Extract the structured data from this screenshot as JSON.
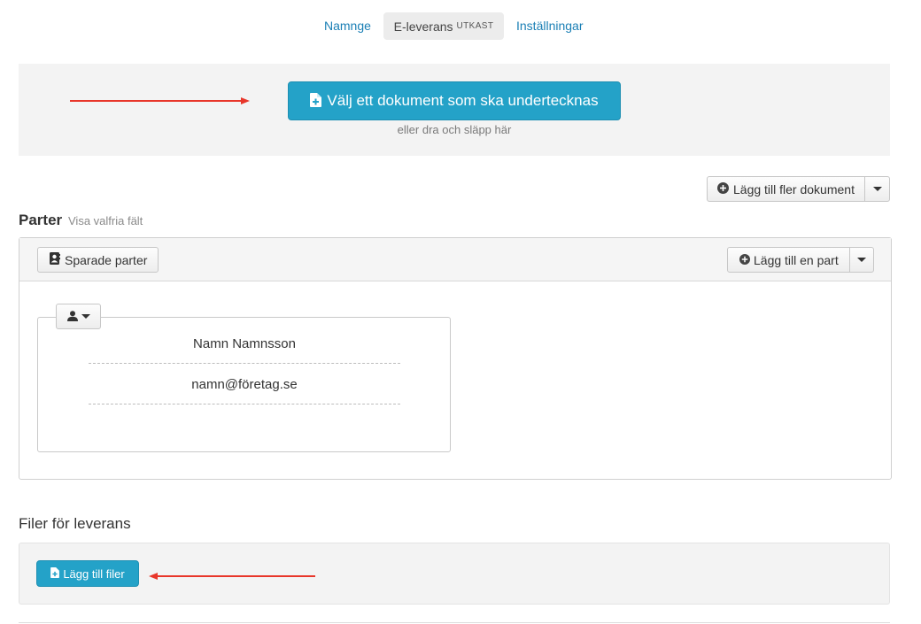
{
  "tabs": {
    "name_label": "Namnge",
    "delivery_label": "E-leverans",
    "delivery_badge": "UTKAST",
    "settings_label": "Inställningar"
  },
  "dropzone": {
    "choose_button_label": "Välj ett dokument som ska undertecknas",
    "drop_hint": "eller dra och släpp här"
  },
  "documents": {
    "add_more_label": "Lägg till fler dokument"
  },
  "parties": {
    "title": "Parter",
    "optional_fields_link": "Visa valfria fält",
    "saved_parties_label": "Sparade parter",
    "add_party_label": "Lägg till en part",
    "party": {
      "name": "Namn Namnsson",
      "email": "namn@företag.se"
    }
  },
  "files": {
    "title": "Filer för leverans",
    "add_files_label": "Lägg till filer"
  },
  "colors": {
    "primary": "#24a2c8",
    "link": "#1a7fb5",
    "annotation_arrow": "#e8362a"
  }
}
